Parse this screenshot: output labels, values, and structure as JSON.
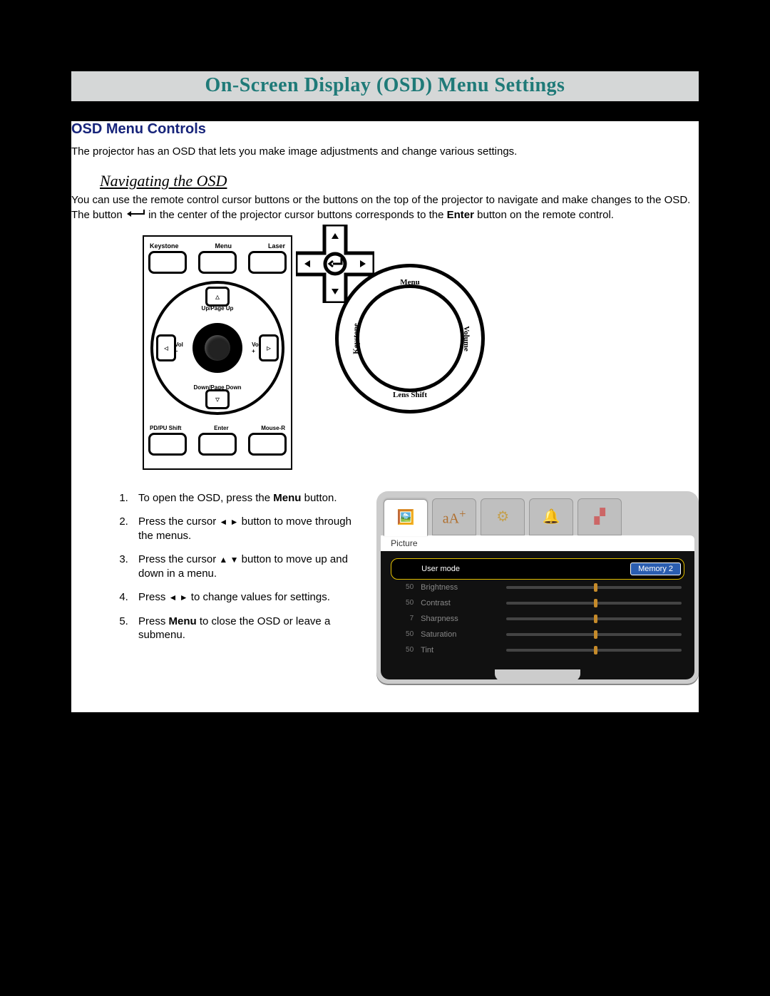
{
  "title": "On-Screen Display (OSD) Menu Settings",
  "sectionHeading": "OSD Menu Controls",
  "intro": "The projector has an OSD that lets you make image adjustments and change various settings.",
  "subhead": "Navigating the OSD",
  "nav_before": "You can use the remote control cursor buttons or the buttons on the top of the projector to navigate and make changes to the OSD. The button ",
  "nav_after": " in the center of the projector cursor buttons corresponds to the ",
  "nav_enter": "Enter",
  "nav_tail": " button on the remote control.",
  "remote": {
    "topLabels": [
      "Keystone",
      "Menu",
      "Laser"
    ],
    "up": "Up/Page Up",
    "down": "Down/Page Down",
    "left": "Vol\n–",
    "right": "Vol\n+",
    "bottomLabels": [
      "PD/PU Shift",
      "Enter",
      "Mouse-R"
    ]
  },
  "dial": {
    "top": "Menu",
    "bottom": "Lens Shift",
    "left": "Keystone",
    "right": "Volume"
  },
  "steps": [
    {
      "pre": "To open the OSD, press the ",
      "mid": "Menu",
      "post": " button."
    },
    {
      "pre": "Press the cursor ",
      "sym": "◄ ►",
      "post": " button to move through the menus."
    },
    {
      "pre": "Press the cursor ",
      "sym": "▲ ▼",
      "post": " button to move up and down in a menu."
    },
    {
      "pre": "Press ",
      "sym": "◄ ►",
      "post": " to change values for settings."
    },
    {
      "pre": "Press ",
      "mid": "Menu",
      "post": " to close the OSD or leave a submenu."
    }
  ],
  "osd": {
    "tabIcons": [
      "picture-icon",
      "text-icon",
      "gear-icon",
      "bell-icon",
      "grid-icon"
    ],
    "headLabel": "Picture",
    "selected": {
      "label": "User mode",
      "value": "Memory 2"
    },
    "rows": [
      {
        "val": "50",
        "lbl": "Brightness"
      },
      {
        "val": "50",
        "lbl": "Contrast"
      },
      {
        "val": "7",
        "lbl": "Sharpness"
      },
      {
        "val": "50",
        "lbl": "Saturation"
      },
      {
        "val": "50",
        "lbl": "Tint"
      }
    ]
  }
}
